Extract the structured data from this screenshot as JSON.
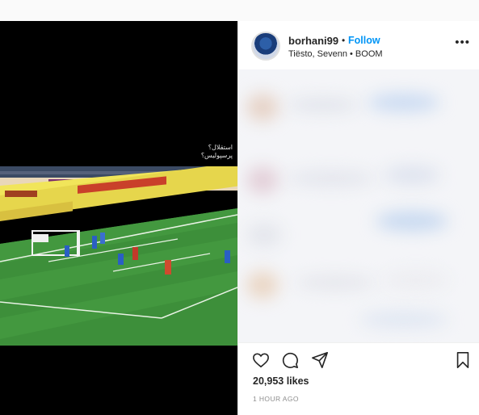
{
  "post": {
    "username": "borhani99",
    "separator": "•",
    "follow_label": "Follow",
    "audio": "Tiësto, Sevenn • BOOM",
    "more_label": "•••"
  },
  "video_overlay": {
    "line1": "استقلال؟",
    "line2": "پرسپولیس؟"
  },
  "actions": {
    "icons": [
      "heart-icon",
      "comment-icon",
      "share-icon",
      "bookmark-icon"
    ]
  },
  "stats": {
    "likes": "20,953 likes",
    "time_ago": "1 HOUR AGO"
  },
  "colors": {
    "link": "#0095f6",
    "text": "#262626",
    "muted": "#8e8e8e",
    "pitch": "#3d8f3a"
  }
}
